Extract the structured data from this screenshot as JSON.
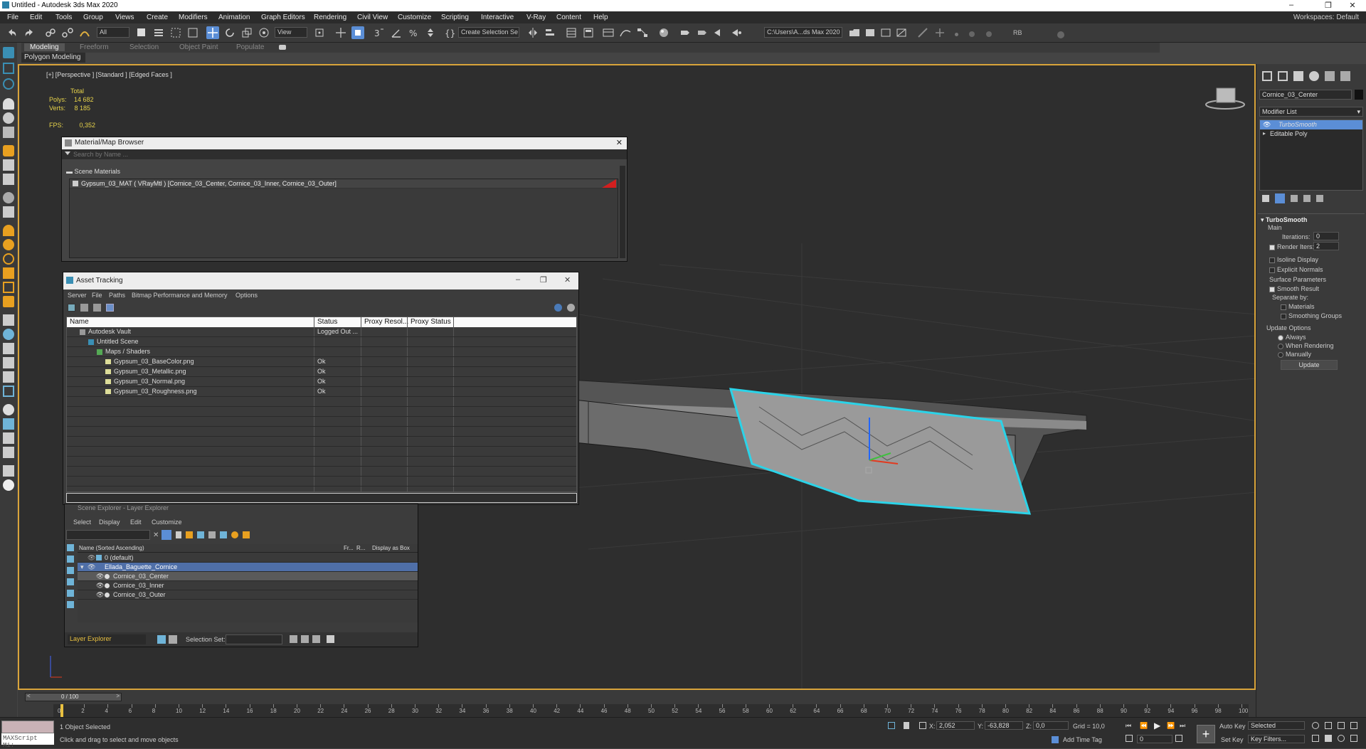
{
  "app": {
    "title": "Untitled - Autodesk 3ds Max 2020",
    "min": "–",
    "max": "❐",
    "close": "✕"
  },
  "menu": [
    "File",
    "Edit",
    "Tools",
    "Group",
    "Views",
    "Create",
    "Modifiers",
    "Animation",
    "Graph Editors",
    "Rendering",
    "Civil View",
    "Customize",
    "Scripting",
    "Interactive",
    "V-Ray",
    "Content",
    "Help"
  ],
  "workspaces": "Workspaces: Default",
  "toolbar": {
    "filter": "All",
    "view": "View",
    "selection_set": "Create Selection Se",
    "path": "C:\\Users\\A...ds Max 2020",
    "rb": "RB"
  },
  "ribbon": {
    "tabs": [
      "Modeling",
      "Freeform",
      "Selection",
      "Object Paint",
      "Populate"
    ],
    "panel": "Polygon Modeling"
  },
  "viewport": {
    "label": "[+] [Perspective ] [Standard ] [Edged Faces ]",
    "stats_total": "Total",
    "polys_label": "Polys:",
    "polys_value": "14 682",
    "verts_label": "Verts:",
    "verts_value": "8 185",
    "fps_label": "FPS:",
    "fps_value": "0,352"
  },
  "material_browser": {
    "title": "Material/Map Browser",
    "search_placeholder": "Search by Name ...",
    "section": "Scene Materials",
    "entry": "Gypsum_03_MAT  ( VRayMtl )  [Cornice_03_Center, Cornice_03_Inner, Cornice_03_Outer]"
  },
  "asset_tracking": {
    "title": "Asset Tracking",
    "menu": [
      "Server",
      "File",
      "Paths",
      "Bitmap Performance and Memory",
      "Options"
    ],
    "columns": [
      "Name",
      "Status",
      "Proxy Resol...",
      "Proxy Status"
    ],
    "rows": [
      {
        "name": "Autodesk Vault",
        "status": "Logged Out ..."
      },
      {
        "name": "Untitled Scene",
        "status": ""
      },
      {
        "name": "Maps / Shaders",
        "status": ""
      },
      {
        "name": "Gypsum_03_BaseColor.png",
        "status": "Ok"
      },
      {
        "name": "Gypsum_03_Metallic.png",
        "status": "Ok"
      },
      {
        "name": "Gypsum_03_Normal.png",
        "status": "Ok"
      },
      {
        "name": "Gypsum_03_Roughness.png",
        "status": "Ok"
      }
    ]
  },
  "scene_explorer": {
    "title": "Scene Explorer - Layer Explorer",
    "menu": [
      "Select",
      "Display",
      "Edit",
      "Customize"
    ],
    "columns": [
      "Name (Sorted Ascending)",
      "Fr...",
      "R...",
      "Display as Box"
    ],
    "rows": [
      "0 (default)",
      "Ellada_Baguette_Cornice",
      "Cornice_03_Center",
      "Cornice_03_Inner",
      "Cornice_03_Outer"
    ],
    "footer_layer": "Layer Explorer",
    "footer_selset": "Selection Set:"
  },
  "command_panel": {
    "object_name": "Cornice_03_Center",
    "modifier_list": "Modifier List",
    "stack": [
      "TurboSmooth",
      "Editable Poly"
    ],
    "rollout": "TurboSmooth",
    "main": "Main",
    "iterations_label": "Iterations:",
    "iterations": "0",
    "render_iters_label": "Render Iters:",
    "render_iters": "2",
    "isoline": "Isoline Display",
    "explicit": "Explicit Normals",
    "surface": "Surface Parameters",
    "smooth": "Smooth Result",
    "separate": "Separate by:",
    "materials": "Materials",
    "smoothing": "Smoothing Groups",
    "update_options": "Update Options",
    "always": "Always",
    "when_rendering": "When Rendering",
    "manually": "Manually",
    "update_btn": "Update"
  },
  "timeline": {
    "frame": "0 / 100",
    "ticks": [
      "0",
      "2",
      "4",
      "6",
      "8",
      "10",
      "12",
      "14",
      "16",
      "18",
      "20",
      "22",
      "24",
      "26",
      "28",
      "30",
      "32",
      "34",
      "36",
      "38",
      "40",
      "42",
      "44",
      "46",
      "48",
      "50",
      "52",
      "54",
      "56",
      "58",
      "60",
      "62",
      "64",
      "66",
      "68",
      "70",
      "72",
      "74",
      "76",
      "78",
      "80",
      "82",
      "84",
      "86",
      "88",
      "90",
      "92",
      "94",
      "96",
      "98",
      "100"
    ]
  },
  "status": {
    "selected": "1 Object Selected",
    "hint": "Click and drag to select and move objects",
    "maxscript": "MAXScript Mi:",
    "x_label": "X:",
    "x": "2,052",
    "y_label": "Y:",
    "y": "-63,828",
    "z_label": "Z:",
    "z": "0,0",
    "grid": "Grid = 10,0",
    "add_time_tag": "Add Time Tag",
    "auto_key": "Auto Key",
    "set_key": "Set Key",
    "selected_dd": "Selected",
    "key_filters": "Key Filters...",
    "frame_field": "0"
  }
}
